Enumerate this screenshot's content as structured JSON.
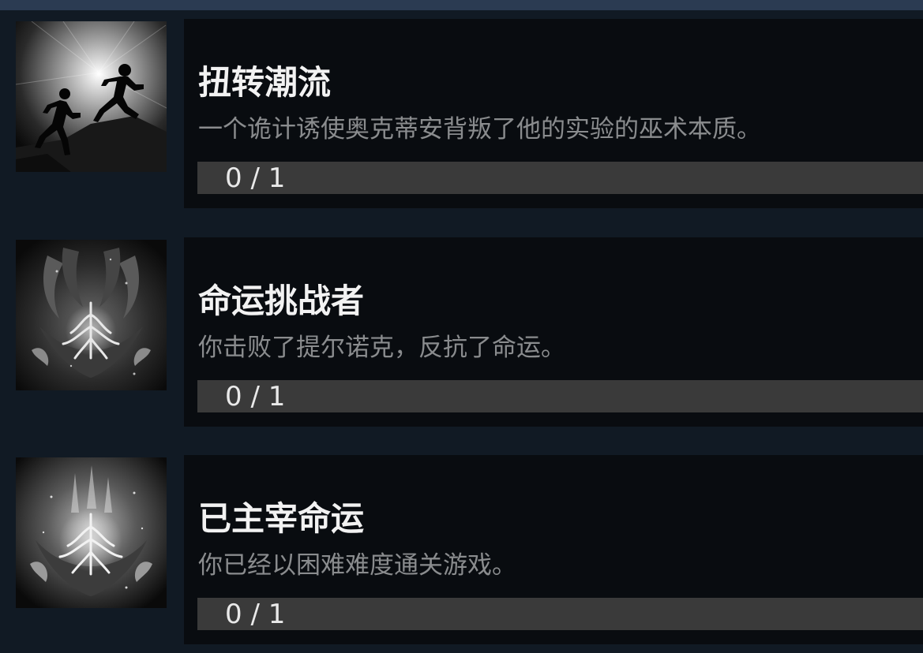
{
  "achievements": [
    {
      "icon": "runners-icon",
      "title": "扭转潮流",
      "description": "一个诡计诱使奥克蒂安背叛了他的实验的巫术本质。",
      "progress_text": "0 / 1",
      "progress": 0
    },
    {
      "icon": "crown-emblem-icon",
      "title": "命运挑战者",
      "description": "你击败了提尔诺克，反抗了命运。",
      "progress_text": "0 / 1",
      "progress": 0
    },
    {
      "icon": "glowing-crown-emblem-icon",
      "title": "已主宰命运",
      "description": "你已经以困难难度通关游戏。",
      "progress_text": "0 / 1",
      "progress": 0
    }
  ]
}
